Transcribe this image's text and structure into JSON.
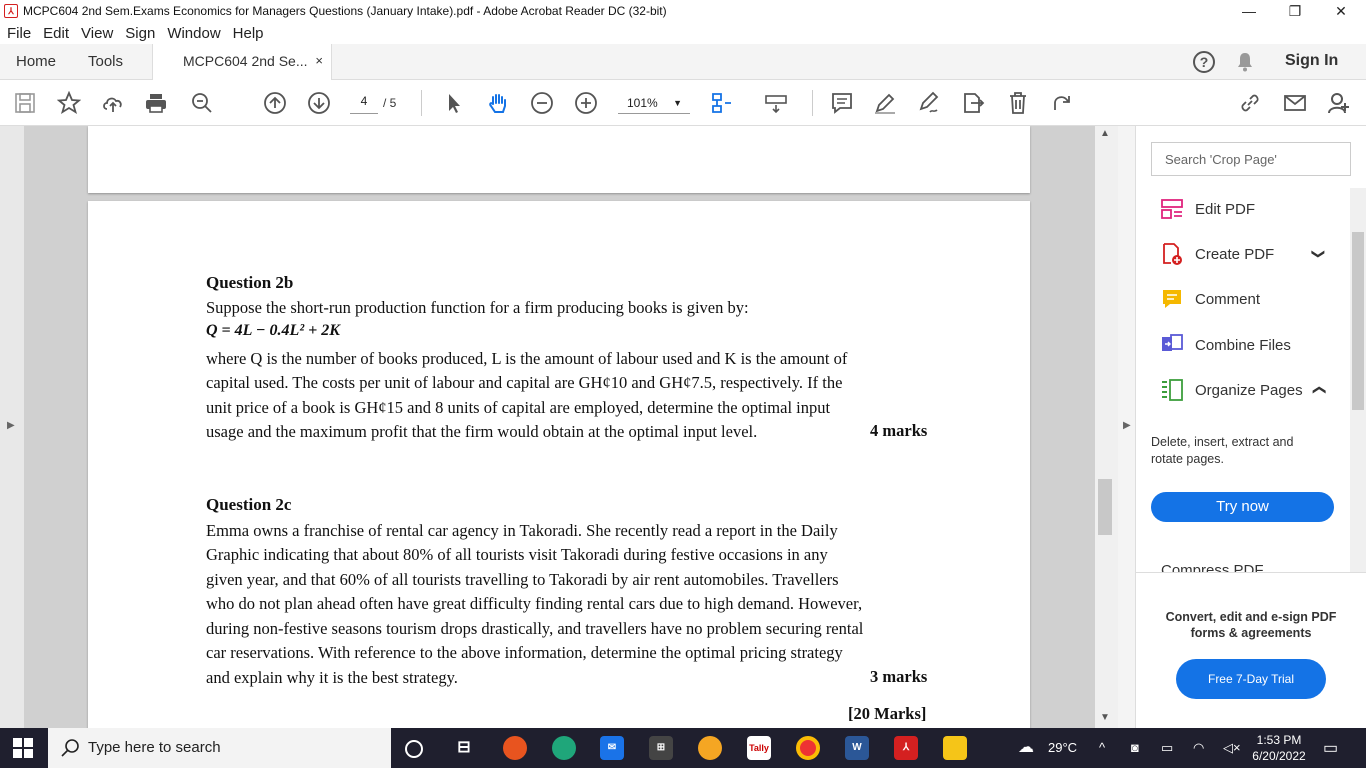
{
  "window": {
    "title": "MCPC604 2nd Sem.Exams Economics for Managers Questions (January Intake).pdf - Adobe Acrobat Reader DC (32-bit)",
    "minimize": "—",
    "restore": "❐",
    "close": "✕"
  },
  "menu": [
    "File",
    "Edit",
    "View",
    "Sign",
    "Window",
    "Help"
  ],
  "tabs": {
    "home": "Home",
    "tools": "Tools",
    "doc": "MCPC604 2nd Se...",
    "close": "×",
    "help": "?",
    "signin": "Sign In"
  },
  "toolbar": {
    "page_current": "4",
    "page_total": "/ 5",
    "zoom": "101%"
  },
  "document": {
    "q2b_title": "Question 2b",
    "q2b_intro": "Suppose the short-run production function for a firm producing books is given by:",
    "q2b_eq": "Q = 4L − 0.4L² + 2K",
    "q2b_lines": [
      "where Q is the number of books produced, L is the amount of labour used and K is the amount of",
      "capital used. The costs per unit of labour and capital are GH¢10 and GH¢7.5, respectively. If the",
      "unit price of a book is GH¢15 and 8 units of capital are employed, determine the optimal input",
      "usage and the maximum profit that the firm would obtain at the optimal input level."
    ],
    "q2b_marks": "4 marks",
    "q2c_title": "Question 2c",
    "q2c_lines": [
      "Emma owns a franchise of rental car agency in Takoradi. She recently read a report in the Daily",
      "Graphic indicating that about 80% of all tourists visit Takoradi during festive occasions in any",
      "given year, and that 60% of all tourists travelling to Takoradi by air rent automobiles. Travellers",
      "who do not plan ahead often have great difficulty finding rental cars due to high demand. However,",
      "during non-festive seasons tourism drops drastically, and travellers have no problem securing rental",
      "car reservations. With reference to the above information, determine the optimal pricing strategy",
      "and explain why it is the best strategy."
    ],
    "q2c_marks": "3 marks",
    "total_marks": "[20 Marks]"
  },
  "right_pane": {
    "search_placeholder": "Search 'Crop Page'",
    "tools": [
      {
        "label": "Edit PDF",
        "icon": "edit-pdf-icon",
        "color": "#e0247d"
      },
      {
        "label": "Create PDF",
        "icon": "create-pdf-icon",
        "color": "#d42020"
      },
      {
        "label": "Comment",
        "icon": "comment-icon",
        "color": "#f5b800"
      },
      {
        "label": "Combine Files",
        "icon": "combine-files-icon",
        "color": "#5a5ad6"
      },
      {
        "label": "Organize Pages",
        "icon": "organize-pages-icon",
        "color": "#3d9e3d"
      }
    ],
    "chev_down": "❯",
    "chev_up": "❯",
    "desc": "Delete, insert, extract and rotate pages.",
    "try_now": "Try now",
    "compress": "Compress PDF",
    "promo": "Convert, edit and e-sign PDF forms & agreements",
    "trial": "Free 7-Day Trial"
  },
  "taskbar": {
    "search": "Type here to search",
    "temperature": "29°C",
    "time": "1:53 PM",
    "date": "6/20/2022"
  },
  "colors": {
    "accent": "#1473e6",
    "taskbar": "#1f1f2e",
    "doc_bg": "#d0d0d0"
  }
}
